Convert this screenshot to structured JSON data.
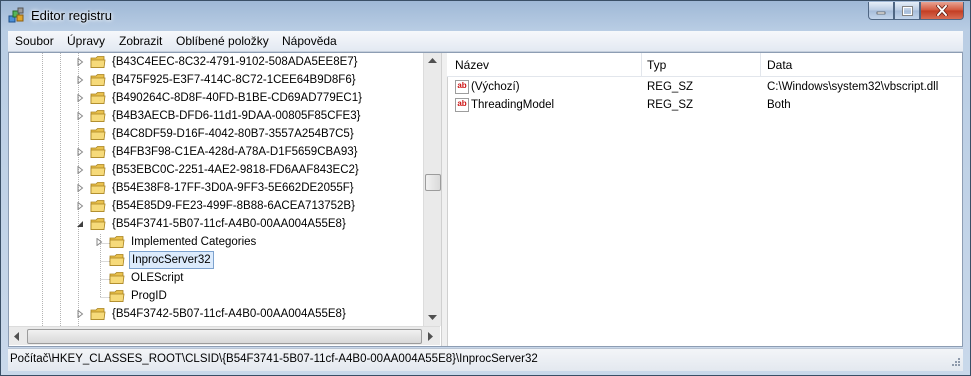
{
  "window": {
    "title": "Editor registru",
    "app_icon": "regedit-icon"
  },
  "menu": [
    {
      "label": "Soubor"
    },
    {
      "label": "Úpravy"
    },
    {
      "label": "Zobrazit"
    },
    {
      "label": "Oblíbené položky"
    },
    {
      "label": "Nápověda"
    }
  ],
  "tree": {
    "items": [
      {
        "label": "{B43C4EEC-8C32-4791-9102-508ADA5EE8E7}",
        "expander": "collapsed"
      },
      {
        "label": "{B475F925-E3F7-414C-8C72-1CEE64B9D8F6}",
        "expander": "collapsed"
      },
      {
        "label": "{B490264C-8D8F-40FD-B1BE-CD69AD779EC1}",
        "expander": "collapsed"
      },
      {
        "label": "{B4B3AECB-DFD6-11d1-9DAA-00805F85CFE3}",
        "expander": "collapsed"
      },
      {
        "label": "{B4C8DF59-D16F-4042-80B7-3557A254B7C5}",
        "expander": "none"
      },
      {
        "label": "{B4FB3F98-C1EA-428d-A78A-D1F5659CBA93}",
        "expander": "collapsed"
      },
      {
        "label": "{B53EBC0C-2251-4AE2-9818-FD6AAF843EC2}",
        "expander": "collapsed"
      },
      {
        "label": "{B54E38F8-17FF-3D0A-9FF3-5E662DE2055F}",
        "expander": "collapsed"
      },
      {
        "label": "{B54E85D9-FE23-499F-8B88-6ACEA713752B}",
        "expander": "collapsed"
      },
      {
        "label": "{B54F3741-5B07-11cf-A4B0-00AA004A55E8}",
        "expander": "expanded"
      },
      {
        "label": "Implemented Categories",
        "expander": "collapsed"
      },
      {
        "label": "InprocServer32",
        "expander": "none",
        "selected": true
      },
      {
        "label": "OLEScript",
        "expander": "none"
      },
      {
        "label": "ProgID",
        "expander": "none"
      },
      {
        "label": "{B54F3742-5B07-11cf-A4B0-00AA004A55E8}",
        "expander": "collapsed"
      }
    ]
  },
  "list": {
    "columns": {
      "name": "Název",
      "type": "Typ",
      "data": "Data"
    },
    "rows": [
      {
        "name": "(Výchozí)",
        "type": "REG_SZ",
        "data": "C:\\Windows\\system32\\vbscript.dll",
        "icon": "string-value-icon"
      },
      {
        "name": "ThreadingModel",
        "type": "REG_SZ",
        "data": "Both",
        "icon": "string-value-icon"
      }
    ]
  },
  "status": {
    "path": "Počítač\\HKEY_CLASSES_ROOT\\CLSID\\{B54F3741-5B07-11cf-A4B0-00AA004A55E8}\\InprocServer32"
  },
  "colors": {
    "folder": "#e8c04c",
    "selection": "#dcebfc",
    "close_button": "#c9442a"
  }
}
